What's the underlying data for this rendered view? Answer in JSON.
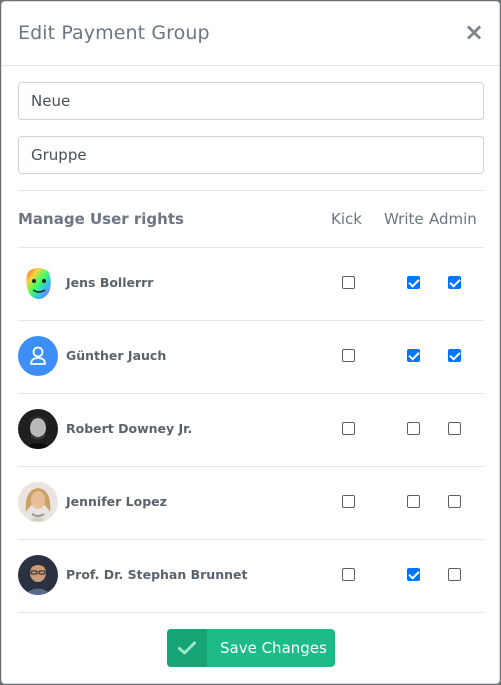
{
  "modal": {
    "title": "Edit Payment Group",
    "close_label": "×"
  },
  "form": {
    "name_value": "Neue",
    "description_value": "Gruppe"
  },
  "rights": {
    "title": "Manage User rights",
    "columns": {
      "kick": "Kick",
      "write": "Write",
      "admin": "Admin"
    }
  },
  "users": [
    {
      "name": "Jens Bollerrr",
      "avatar": "rainbow-face-photo",
      "kick": false,
      "write": true,
      "admin": true
    },
    {
      "name": "Günther Jauch",
      "avatar": "default-user-icon",
      "kick": false,
      "write": true,
      "admin": true
    },
    {
      "name": "Robert Downey Jr.",
      "avatar": "portrait-photo",
      "kick": false,
      "write": false,
      "admin": false
    },
    {
      "name": "Jennifer Lopez",
      "avatar": "portrait-photo",
      "kick": false,
      "write": false,
      "admin": false
    },
    {
      "name": "Prof. Dr. Stephan Brunnet",
      "avatar": "portrait-photo",
      "kick": false,
      "write": true,
      "admin": false
    }
  ],
  "footer": {
    "save_label": "Save Changes",
    "save_icon": "check-icon"
  },
  "colors": {
    "checkbox_checked": "#0075ff",
    "save_button": "#1dbb87",
    "save_icon_box": "#17a577",
    "default_avatar": "#3d8ef7"
  }
}
